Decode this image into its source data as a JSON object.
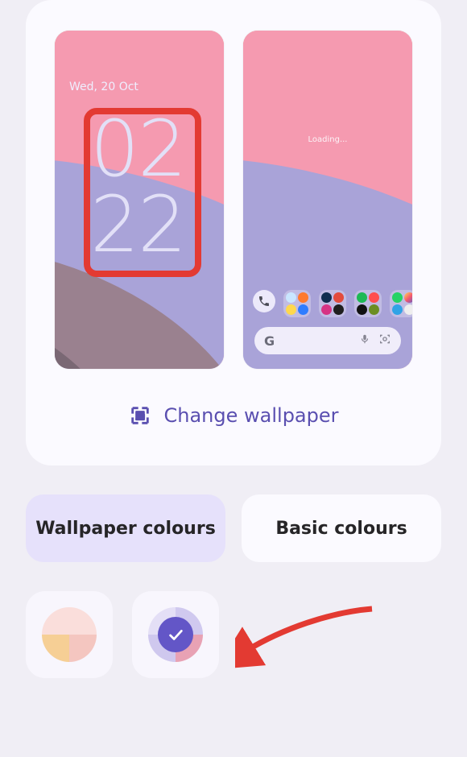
{
  "colors": {
    "accent": "#6356c7",
    "highlight": "#e33a32"
  },
  "lock_screen": {
    "date": "Wed, 20 Oct",
    "time": "02\n22"
  },
  "home_screen": {
    "loading_text": "Loading...",
    "search_letter": "G"
  },
  "change_wallpaper": {
    "label": "Change wallpaper"
  },
  "tabs": {
    "wallpaper": "Wallpaper colours",
    "basic": "Basic colours",
    "active": "wallpaper"
  },
  "swatches": [
    {
      "id": "peach",
      "colors": [
        "#f9d8d3",
        "#f9d8d3",
        "#f6cf95",
        "#f4c6c0"
      ],
      "selected": false
    },
    {
      "id": "violet",
      "colors": [
        "#e2ddf4",
        "#c9c2ed",
        "#6356c7",
        "#d9d3f3"
      ],
      "selected": true
    }
  ],
  "icons": {
    "wallpaper_icon": "wallpaper-icon",
    "mic_icon": "mic-icon",
    "lens_icon": "lens-icon",
    "check_icon": "check-icon",
    "phone_icon": "phone-icon"
  }
}
